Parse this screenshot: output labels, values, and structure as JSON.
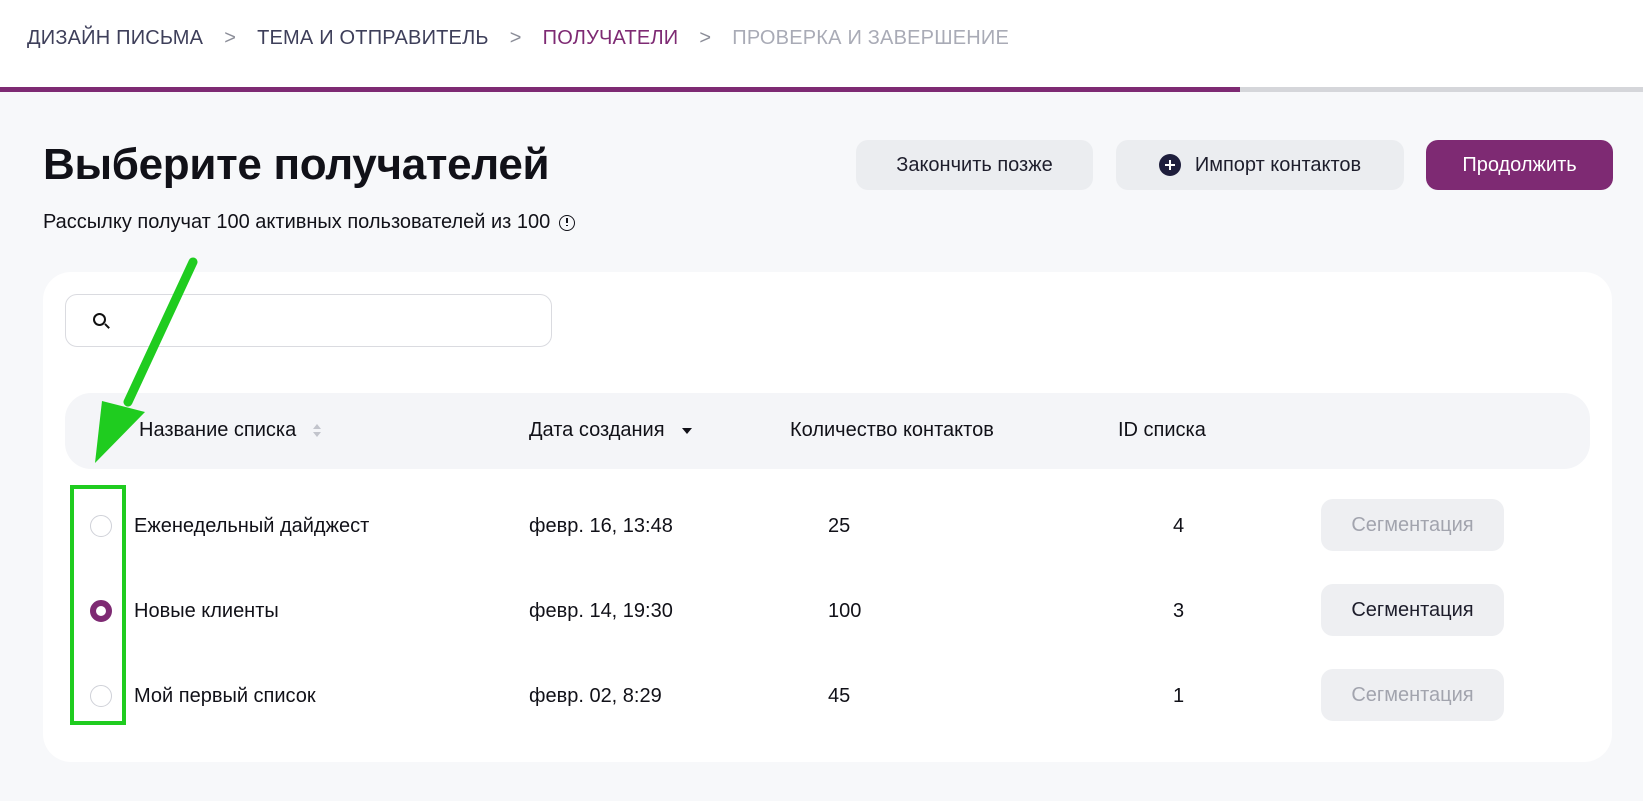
{
  "wizard": {
    "steps": [
      {
        "label": "ДИЗАЙН ПИСЬМА",
        "state": "done"
      },
      {
        "label": "ТЕМА И ОТПРАВИТЕЛЬ",
        "state": "done"
      },
      {
        "label": "ПОЛУЧАТЕЛИ",
        "state": "active"
      },
      {
        "label": "ПРОВЕРКА И ЗАВЕРШЕНИЕ",
        "state": "pending"
      }
    ],
    "separator": ">",
    "progress": 0.755
  },
  "header": {
    "title": "Выберите получателей",
    "subtitle": "Рассылку получат 100 активных пользователей из 100"
  },
  "actions": {
    "finish_later": "Закончить позже",
    "import_contacts": "Импорт контактов",
    "continue": "Продолжить"
  },
  "search": {
    "placeholder": "",
    "value": ""
  },
  "table": {
    "columns": {
      "name": "Название списка",
      "created": "Дата создания",
      "count": "Количество контактов",
      "id": "ID списка"
    },
    "segment_label": "Сегментация",
    "rows": [
      {
        "name": "Еженедельный дайджест",
        "created": "февр. 16, 13:48",
        "count": "25",
        "id": "4",
        "selected": false
      },
      {
        "name": "Новые клиенты",
        "created": "февр. 14, 19:30",
        "count": "100",
        "id": "3",
        "selected": true
      },
      {
        "name": "Мой первый список",
        "created": "февр. 02, 8:29",
        "count": "45",
        "id": "1",
        "selected": false
      }
    ]
  },
  "colors": {
    "accent": "#7e2a73",
    "annotation": "#1fcc1f",
    "background": "#f7f8fa"
  }
}
